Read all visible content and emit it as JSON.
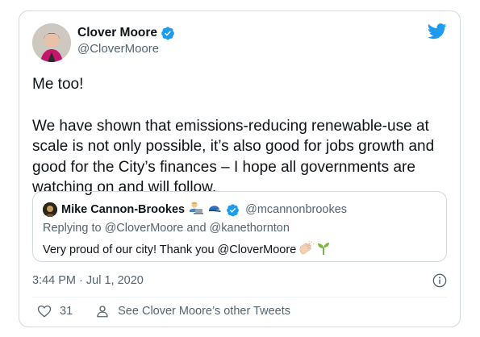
{
  "author": {
    "name": "Clover Moore",
    "handle": "@CloverMoore"
  },
  "tweet": {
    "line1": "Me too!",
    "paragraph": "We have shown that emissions-reducing renewable-use at scale is not only possible, it’s also good for jobs growth and good for the City’s finances – I hope all governments are watching on and will follow."
  },
  "quote": {
    "name": "Mike Cannon-Brookes",
    "handle": "@mcannonbrookes",
    "replying": "Replying to @CloverMoore and @kanethornton",
    "text": "Very proud of our city! Thank you @CloverMoore",
    "emojis": [
      "man-technologist-emoji",
      "blue-cap-emoji",
      "clapping-hands-emoji",
      "seedling-emoji"
    ]
  },
  "meta": {
    "timestamp": "3:44 PM · Jul 1, 2020"
  },
  "actions": {
    "likes": "31",
    "other_tweets": "See Clover Moore’s other Tweets"
  },
  "colors": {
    "twitter_blue": "#1d9bf0",
    "secondary_text": "#536471",
    "border": "#cfd9de"
  }
}
